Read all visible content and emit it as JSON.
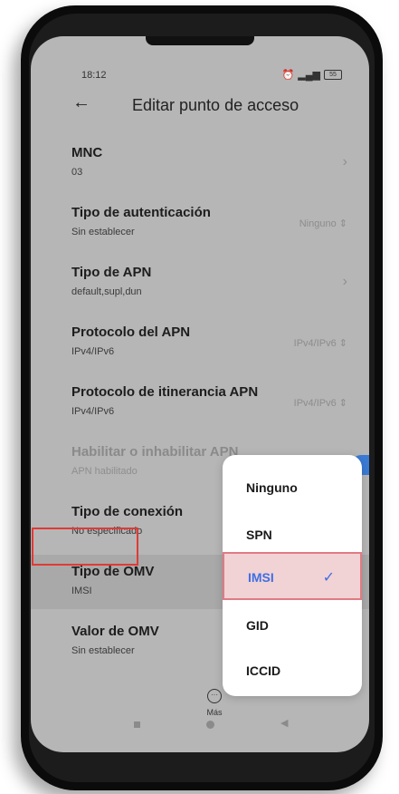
{
  "status": {
    "time": "18:12",
    "battery": "55"
  },
  "header": {
    "title": "Editar punto de acceso"
  },
  "rows": [
    {
      "title": "MNC",
      "sub": "03",
      "value": ""
    },
    {
      "title": "Tipo de autenticación",
      "sub": "Sin establecer",
      "value": "Ninguno"
    },
    {
      "title": "Tipo de APN",
      "sub": "default,supl,dun",
      "value": ""
    },
    {
      "title": "Protocolo del APN",
      "sub": "IPv4/IPv6",
      "value": "IPv4/IPv6"
    },
    {
      "title": "Protocolo de itinerancia APN",
      "sub": "IPv4/IPv6",
      "value": "IPv4/IPv6"
    },
    {
      "title": "Habilitar o inhabilitar APN",
      "sub": "APN habilitado",
      "value": ""
    },
    {
      "title": "Tipo de conexión",
      "sub": "No especificado",
      "value": ""
    },
    {
      "title": "Tipo de OMV",
      "sub": "IMSI",
      "value": ""
    },
    {
      "title": "Valor de OMV",
      "sub": "Sin establecer",
      "value": ""
    }
  ],
  "more": {
    "label": "Más"
  },
  "menu": {
    "options": [
      "Ninguno",
      "SPN",
      "IMSI",
      "GID",
      "ICCID"
    ],
    "selected": "IMSI"
  },
  "colors": {
    "accent": "#3f6fe3",
    "highlight": "#e03a36",
    "selected_bg": "#f1d2d5"
  }
}
